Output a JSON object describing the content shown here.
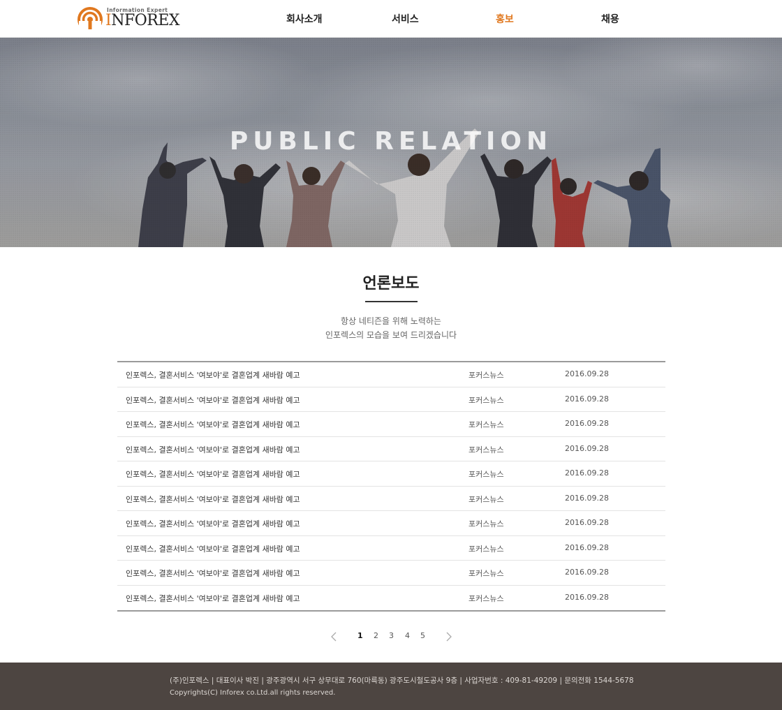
{
  "header": {
    "logo": {
      "tagline": "Information Expert",
      "word_accent": "I",
      "word_rest": "NFOREX"
    },
    "nav": [
      {
        "label": "회사소개",
        "active": false
      },
      {
        "label": "서비스",
        "active": false
      },
      {
        "label": "홍보",
        "active": true
      },
      {
        "label": "채용",
        "active": false
      }
    ]
  },
  "hero": {
    "title": "PUBLIC RELATION"
  },
  "section": {
    "title": "언론보도",
    "subtitle_lines": [
      "항상 네티즌을 위해 노력하는",
      "인포렉스의 모습을 보여 드리겠습니다"
    ]
  },
  "news": [
    {
      "title": "인포렉스, 결혼서비스 '여보야'로 결혼업계 새바람 예고",
      "source": "포커스뉴스",
      "date": "2016.09.28"
    },
    {
      "title": "인포렉스, 결혼서비스 '여보야'로 결혼업계 새바람 예고",
      "source": "포커스뉴스",
      "date": "2016.09.28"
    },
    {
      "title": "인포렉스, 결혼서비스 '여보야'로 결혼업계 새바람 예고",
      "source": "포커스뉴스",
      "date": "2016.09.28"
    },
    {
      "title": "인포렉스, 결혼서비스 '여보야'로 결혼업계 새바람 예고",
      "source": "포커스뉴스",
      "date": "2016.09.28"
    },
    {
      "title": "인포렉스, 결혼서비스 '여보야'로 결혼업계 새바람 예고",
      "source": "포커스뉴스",
      "date": "2016.09.28"
    },
    {
      "title": "인포렉스, 결혼서비스 '여보야'로 결혼업계 새바람 예고",
      "source": "포커스뉴스",
      "date": "2016.09.28"
    },
    {
      "title": "인포렉스, 결혼서비스 '여보야'로 결혼업계 새바람 예고",
      "source": "포커스뉴스",
      "date": "2016.09.28"
    },
    {
      "title": "인포렉스, 결혼서비스 '여보야'로 결혼업계 새바람 예고",
      "source": "포커스뉴스",
      "date": "2016.09.28"
    },
    {
      "title": "인포렉스, 결혼서비스 '여보야'로 결혼업계 새바람 예고",
      "source": "포커스뉴스",
      "date": "2016.09.28"
    },
    {
      "title": "인포렉스, 결혼서비스 '여보야'로 결혼업계 새바람 예고",
      "source": "포커스뉴스",
      "date": "2016.09.28"
    }
  ],
  "pagination": {
    "pages": [
      "1",
      "2",
      "3",
      "4",
      "5"
    ],
    "current": "1",
    "prev_icon": "chevron-left-icon",
    "next_icon": "chevron-right-icon"
  },
  "footer": {
    "info_line": "(주)인포렉스  |  대표이사 박진  |  광주광역시 서구 상무대로 760(마륵동) 광주도시철도공사 9층  |  사업자번호 : 409-81-49209  |  문의전화 1544-5678",
    "copyright": "Copyrights(C) Inforex co.Ltd.all rights reserved."
  },
  "colors": {
    "accent": "#e0781f",
    "footer_bg": "#4d4541",
    "text_dark": "#222222"
  }
}
